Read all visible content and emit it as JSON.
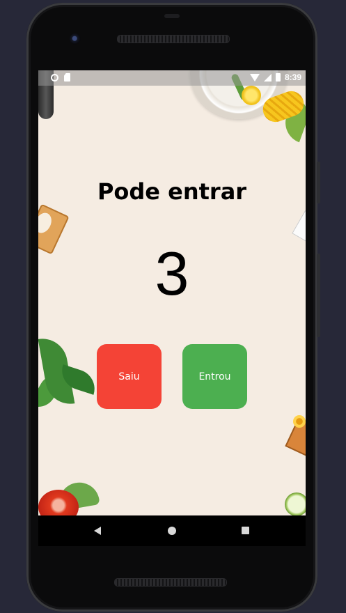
{
  "status_bar": {
    "time": "8:39",
    "icons": [
      "circle-notification-icon",
      "sd-card-icon",
      "wifi-icon",
      "signal-icon",
      "battery-icon"
    ]
  },
  "main": {
    "status_message": "Pode entrar",
    "count": "3",
    "buttons": {
      "left_label": "Saiu",
      "right_label": "Entrou"
    }
  },
  "navigation": {
    "icons": [
      "back-icon",
      "home-icon",
      "recents-icon"
    ]
  },
  "colors": {
    "background": "#f5ece2",
    "exit_button": "#f44336",
    "enter_button": "#4caf50",
    "text": "#000000"
  }
}
